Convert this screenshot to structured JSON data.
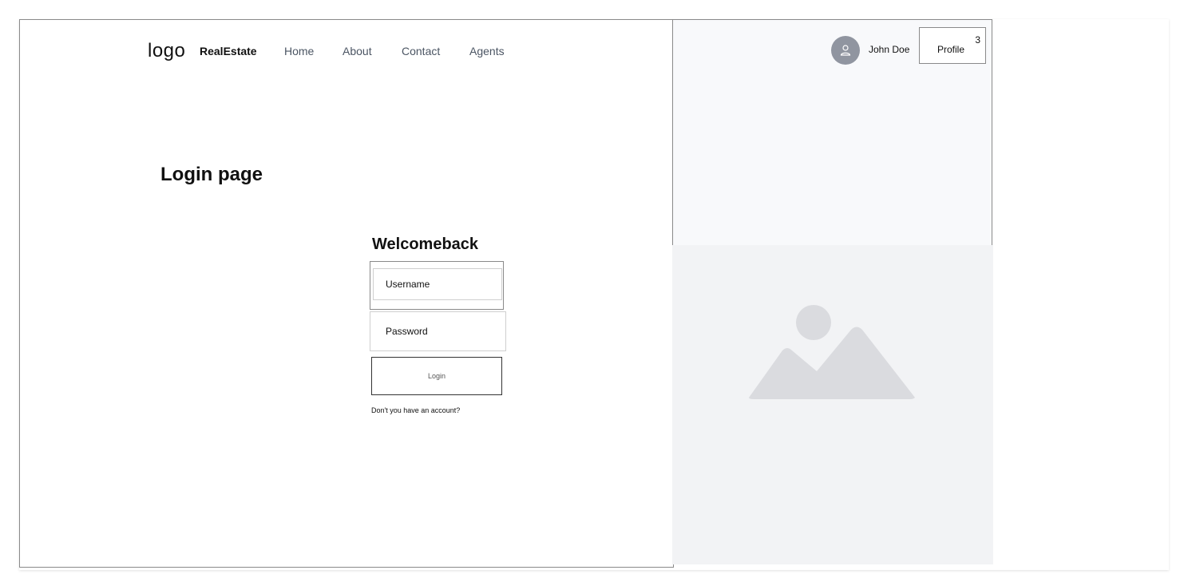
{
  "header": {
    "logo": "logo",
    "brand": "RealEstate",
    "nav": [
      "Home",
      "About",
      "Contact",
      "Agents"
    ]
  },
  "main": {
    "page_title": "Login page",
    "welcome": "Welcomeback",
    "username_placeholder": "Username",
    "password_placeholder": "Password",
    "login_button": "Login",
    "signup_link": "Don't you have an account?"
  },
  "user": {
    "name": "John Doe",
    "profile_label": "Profile",
    "profile_count": "3"
  },
  "icons": {
    "avatar": "user-icon",
    "image": "image-placeholder-icon"
  },
  "colors": {
    "avatar_bg": "#9095a0",
    "panel_bg": "#f8f9fb",
    "image_panel_bg": "#f2f3f5",
    "placeholder_shape": "#dadbdf"
  }
}
